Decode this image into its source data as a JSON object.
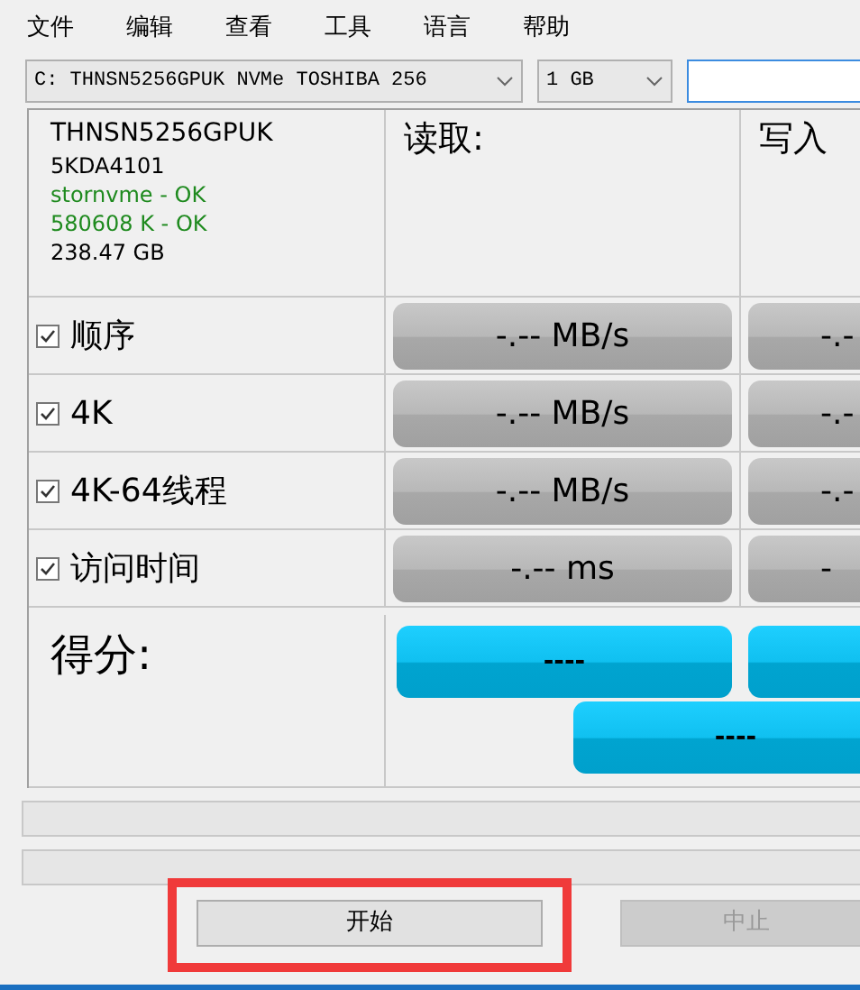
{
  "menu": [
    "文件",
    "编辑",
    "查看",
    "工具",
    "语言",
    "帮助"
  ],
  "drive_select": {
    "value": "C: THNSN5256GPUK NVMe TOSHIBA 256"
  },
  "size_select": {
    "value": "1 GB"
  },
  "drive_info": [
    {
      "text": "THNSN5256GPUK",
      "kind": "model"
    },
    {
      "text": "5KDA4101",
      "kind": "plain"
    },
    {
      "text": "stornvme - OK",
      "kind": "ok"
    },
    {
      "text": "580608 K - OK",
      "kind": "ok"
    },
    {
      "text": "238.47 GB",
      "kind": "plain"
    }
  ],
  "columns": [
    "读取:",
    "写入"
  ],
  "tests": [
    {
      "label": "顺序",
      "checked": true,
      "read": "-.-- MB/s",
      "write": "-.-"
    },
    {
      "label": "4K",
      "checked": true,
      "read": "-.-- MB/s",
      "write": "-.-"
    },
    {
      "label": "4K-64线程",
      "checked": true,
      "read": "-.-- MB/s",
      "write": "-.-"
    },
    {
      "label": "访问时间",
      "checked": true,
      "read": "-.-- ms",
      "write": "-"
    }
  ],
  "score": {
    "label": "得分:",
    "read": "----",
    "total": "----"
  },
  "progress_bars": [
    {
      "level": 0
    },
    {
      "level": 0
    }
  ],
  "buttons": [
    {
      "label": "开始",
      "disabled": false,
      "highlighted": true
    },
    {
      "label": "中止",
      "disabled": true,
      "highlighted": false
    }
  ]
}
